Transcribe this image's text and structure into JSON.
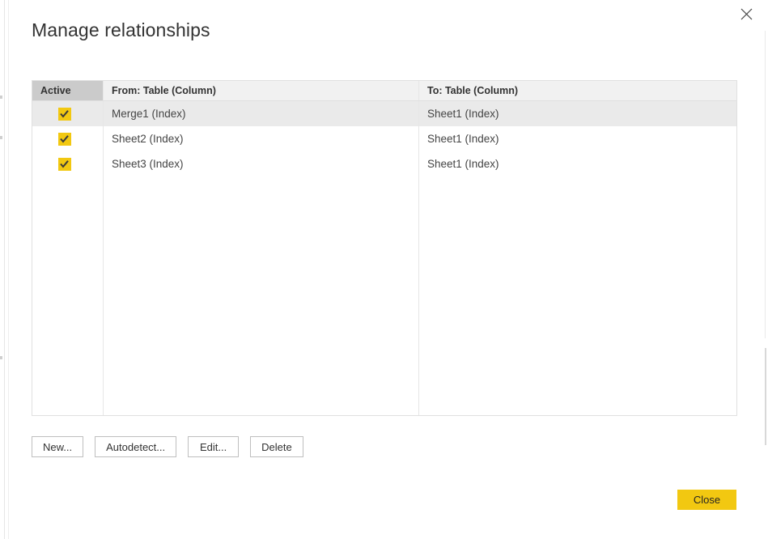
{
  "dialog": {
    "title": "Manage relationships",
    "close_icon": "close-x-icon"
  },
  "table": {
    "columns": [
      {
        "key": "active",
        "label": "Active"
      },
      {
        "key": "from",
        "label": "From: Table (Column)"
      },
      {
        "key": "to",
        "label": "To: Table (Column)"
      }
    ],
    "rows": [
      {
        "active": true,
        "from": "Merge1 (Index)",
        "to": "Sheet1 (Index)",
        "selected": true
      },
      {
        "active": true,
        "from": "Sheet2 (Index)",
        "to": "Sheet1 (Index)",
        "selected": false
      },
      {
        "active": true,
        "from": "Sheet3 (Index)",
        "to": "Sheet1 (Index)",
        "selected": false
      }
    ]
  },
  "actions": {
    "new_label": "New...",
    "autodetect_label": "Autodetect...",
    "edit_label": "Edit...",
    "delete_label": "Delete"
  },
  "footer": {
    "close_label": "Close"
  },
  "colors": {
    "accent": "#F2C811",
    "header_active_bg": "#CBCBCB",
    "header_bg": "#F1F1F1",
    "row_selected_bg": "#EAEAEA",
    "text": "#333333",
    "border": "#E0E0E0"
  }
}
